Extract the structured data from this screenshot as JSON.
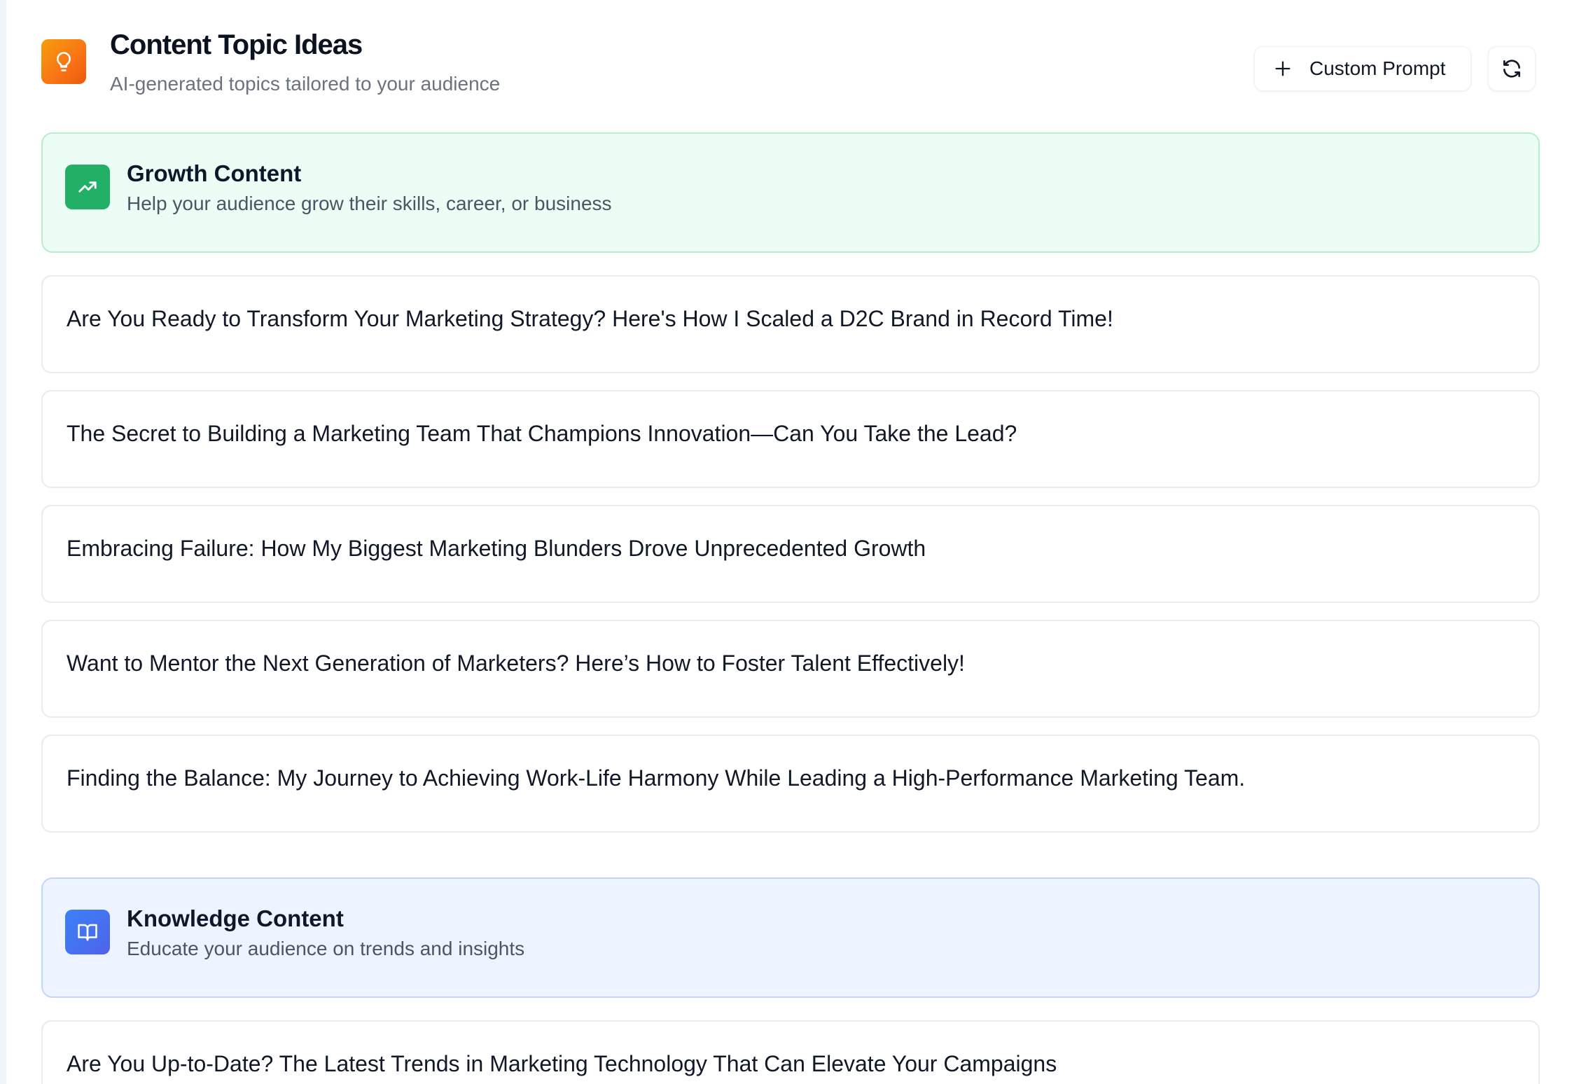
{
  "header": {
    "title": "Content Topic Ideas",
    "subtitle": "AI-generated topics tailored to your audience",
    "icon": "lightbulb-icon",
    "custom_prompt_label": "Custom Prompt",
    "refresh_icon": "refresh-icon"
  },
  "colors": {
    "accent_orange": "#f97316",
    "growth_green": "#22b066",
    "knowledge_blue": "#3b82f6"
  },
  "sections": [
    {
      "title": "Growth Content",
      "description": "Help your audience grow their skills, career, or business",
      "icon": "trending-up-icon",
      "topics": [
        "Are You Ready to Transform Your Marketing Strategy? Here's How I Scaled a D2C Brand in Record Time!",
        "The Secret to Building a Marketing Team That Champions Innovation—Can You Take the Lead?",
        "Embracing Failure: How My Biggest Marketing Blunders Drove Unprecedented Growth",
        "Want to Mentor the Next Generation of Marketers? Here’s How to Foster Talent Effectively!",
        "Finding the Balance: My Journey to Achieving Work-Life Harmony While Leading a High-Performance Marketing Team."
      ]
    },
    {
      "title": "Knowledge Content",
      "description": "Educate your audience on trends and insights",
      "icon": "book-open-icon",
      "topics": [
        "Are You Up-to-Date? The Latest Trends in Marketing Technology That Can Elevate Your Campaigns"
      ]
    }
  ]
}
